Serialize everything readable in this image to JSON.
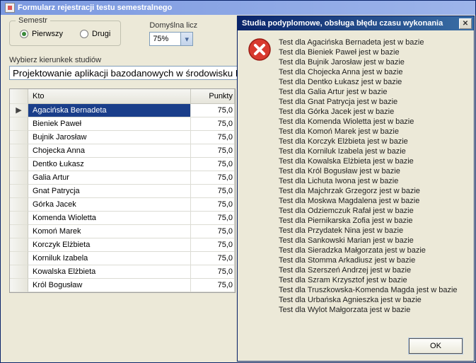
{
  "window": {
    "title": "Formularz rejestracji testu semestralnego"
  },
  "semester": {
    "group_label": "Semestr",
    "opt1": "Pierwszy",
    "opt2": "Drugi"
  },
  "threshold": {
    "label": "Domyślna licz",
    "value": "75%"
  },
  "direction_label": "Wybierz kierunkek studiów",
  "direction_value": "Projektowanie aplikacji bazodanowych w środowisku MS Windo",
  "grid": {
    "col_kto": "Kto",
    "col_punkty": "Punkty",
    "rows": [
      {
        "name": "Agacińska Bernadeta",
        "pts": "75,0"
      },
      {
        "name": "Bieniek Paweł",
        "pts": "75,0"
      },
      {
        "name": "Bujnik Jarosław",
        "pts": "75,0"
      },
      {
        "name": "Chojecka Anna",
        "pts": "75,0"
      },
      {
        "name": "Dentko Łukasz",
        "pts": "75,0"
      },
      {
        "name": "Galia Artur",
        "pts": "75,0"
      },
      {
        "name": "Gnat Patrycja",
        "pts": "75,0"
      },
      {
        "name": "Górka Jacek",
        "pts": "75,0"
      },
      {
        "name": "Komenda Wioletta",
        "pts": "75,0"
      },
      {
        "name": "Komoń Marek",
        "pts": "75,0"
      },
      {
        "name": "Korczyk Elżbieta",
        "pts": "75,0"
      },
      {
        "name": "Korniluk Izabela",
        "pts": "75,0"
      },
      {
        "name": "Kowalska Elżbieta",
        "pts": "75,0"
      },
      {
        "name": "Król Bogusław",
        "pts": "75,0"
      }
    ]
  },
  "dialog": {
    "title": "Studia podyplomowe, obsługa błędu czasu wykonania",
    "ok": "OK",
    "lines": [
      "Test dla Agacińska Bernadeta jest w bazie",
      "Test dla Bieniek Paweł jest w bazie",
      "Test dla Bujnik Jarosław jest w bazie",
      "Test dla Chojecka Anna jest w bazie",
      "Test dla Dentko Łukasz jest w bazie",
      "Test dla Galia Artur jest w bazie",
      "Test dla Gnat Patrycja jest w bazie",
      "Test dla Górka Jacek jest w bazie",
      "Test dla Komenda Wioletta jest w bazie",
      "Test dla Komoń Marek jest w bazie",
      "Test dla Korczyk Elżbieta jest w bazie",
      "Test dla Korniluk Izabela jest w bazie",
      "Test dla Kowalska Elżbieta jest w bazie",
      "Test dla Król Bogusław jest w bazie",
      "Test dla Lichuta Iwona jest w bazie",
      "Test dla Majchrzak Grzegorz jest w bazie",
      "Test dla Moskwa Magdalena jest w bazie",
      "Test dla Odziemczuk Rafał jest w bazie",
      "Test dla Piernikarska Zofia jest w bazie",
      "Test dla Przydatek Nina jest w bazie",
      "Test dla Sankowski Marian jest w bazie",
      "Test dla Sieradzka Małgorzata jest w bazie",
      "Test dla Stomma Arkadiusz jest w bazie",
      "Test dla Szerszeń Andrzej jest w bazie",
      "Test dla Szram Krzysztof jest w bazie",
      "Test dla Truszkowska-Komenda Magda jest w bazie",
      "Test dla Urbańska Agnieszka jest w bazie",
      "Test dla Wylot Małgorzata jest w bazie"
    ]
  }
}
